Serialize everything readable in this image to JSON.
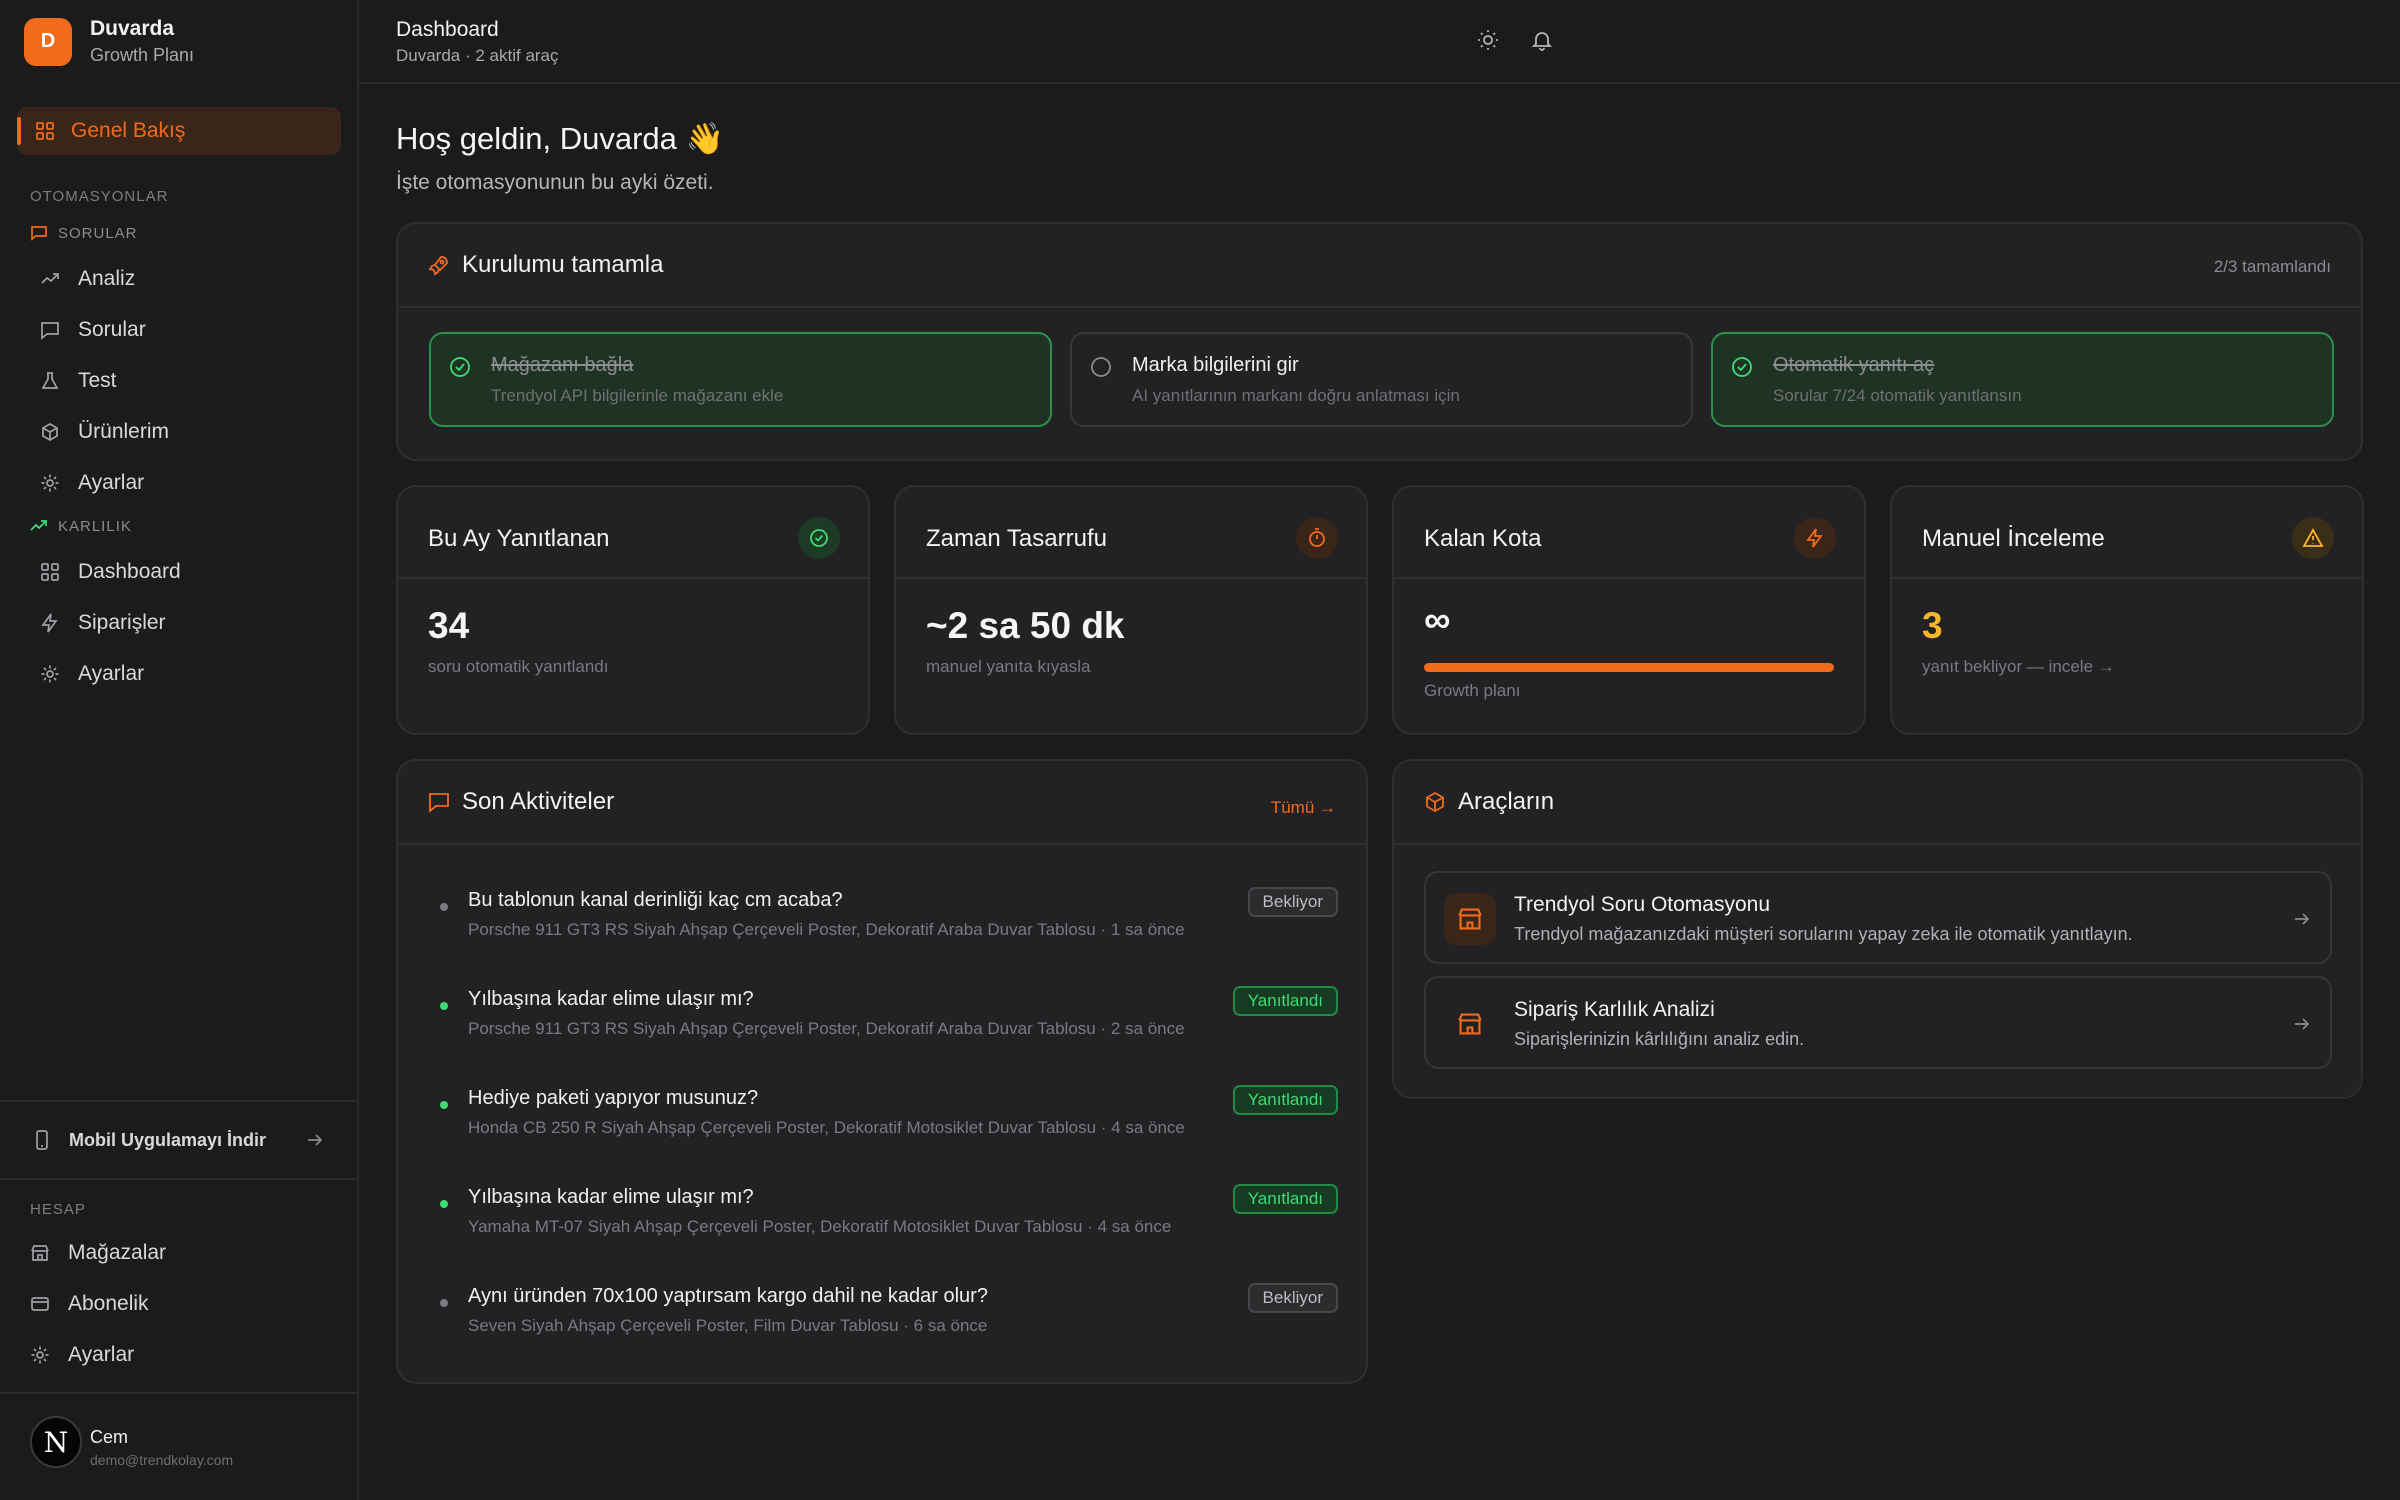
{
  "brand": {
    "initial": "D",
    "name": "Duvarda",
    "plan": "Growth Planı"
  },
  "sidebar": {
    "overview": "Genel Bakış",
    "section_automations": "OTOMASYONLAR",
    "group_questions": "SORULAR",
    "questions_items": [
      "Analiz",
      "Sorular",
      "Test",
      "Ürünlerim",
      "Ayarlar"
    ],
    "group_profit": "KARLILIK",
    "profit_items": [
      "Dashboard",
      "Siparişler",
      "Ayarlar"
    ],
    "mobile": "Mobil Uygulamayı İndir",
    "section_account": "HESAP",
    "account_items": [
      "Mağazalar",
      "Abonelik",
      "Ayarlar"
    ]
  },
  "user": {
    "initial": "N",
    "name": "Cem",
    "email": "demo@trendkolay.com"
  },
  "header": {
    "title": "Dashboard",
    "subtitle": "Duvarda · 2 aktif araç"
  },
  "welcome": {
    "title": "Hoş geldin, Duvarda 👋",
    "subtitle": "İşte otomasyonunun bu ayki özeti."
  },
  "setup": {
    "title": "Kurulumu tamamla",
    "progress": "2/3 tamamlandı",
    "steps": [
      {
        "title": "Mağazanı bağla",
        "desc": "Trendyol API bilgilerinle mağazanı ekle",
        "done": true
      },
      {
        "title": "Marka bilgilerini gir",
        "desc": "AI yanıtlarının markanı doğru anlatması için",
        "done": false
      },
      {
        "title": "Otomatik yanıtı aç",
        "desc": "Sorular 7/24 otomatik yanıtlansın",
        "done": true
      }
    ]
  },
  "stats": [
    {
      "title": "Bu Ay Yanıtlanan",
      "value": "34",
      "label": "soru otomatik yanıtlandı",
      "icon": "check-circle-icon"
    },
    {
      "title": "Zaman Tasarrufu",
      "value": "~2 sa 50 dk",
      "label": "manuel yanıta kıyasla",
      "icon": "timer-icon"
    },
    {
      "title": "Kalan Kota",
      "value": "∞",
      "label": "Growth planı",
      "icon": "bolt-icon",
      "quota_fraction": 1.0
    },
    {
      "title": "Manuel İnceleme",
      "value": "3",
      "label": "yanıt bekliyor — incele →",
      "icon": "warning-icon"
    }
  ],
  "activity": {
    "title": "Son Aktiviteler",
    "all_link": "Tümü →",
    "items": [
      {
        "question": "Bu tablonun kanal derinliği kaç cm acaba?",
        "meta": "Porsche 911 GT3 RS Siyah Ahşap Çerçeveli Poster, Dekoratif Araba Duvar Tablosu · 1 sa önce",
        "status": "Bekliyor",
        "answered": false
      },
      {
        "question": "Yılbaşına kadar elime ulaşır mı?",
        "meta": "Porsche 911 GT3 RS Siyah Ahşap Çerçeveli Poster, Dekoratif Araba Duvar Tablosu · 2 sa önce",
        "status": "Yanıtlandı",
        "answered": true
      },
      {
        "question": "Hediye paketi yapıyor musunuz?",
        "meta": "Honda CB 250 R Siyah Ahşap Çerçeveli Poster, Dekoratif Motosiklet Duvar Tablosu · 4 sa önce",
        "status": "Yanıtlandı",
        "answered": true
      },
      {
        "question": "Yılbaşına kadar elime ulaşır mı?",
        "meta": "Yamaha MT-07 Siyah Ahşap Çerçeveli Poster, Dekoratif Motosiklet Duvar Tablosu · 4 sa önce",
        "status": "Yanıtlandı",
        "answered": true
      },
      {
        "question": "Aynı üründen 70x100 yaptırsam kargo dahil ne kadar olur?",
        "meta": "Seven Siyah Ahşap Çerçeveli Poster, Film Duvar Tablosu · 6 sa önce",
        "status": "Bekliyor",
        "answered": false
      }
    ]
  },
  "tools": {
    "title": "Araçların",
    "items": [
      {
        "title": "Trendyol Soru Otomasyonu",
        "desc": "Trendyol mağazanızdaki müşteri sorularını yapay zeka ile otomatik yanıtlayın."
      },
      {
        "title": "Sipariş Karlılık Analizi",
        "desc": "Siparişlerinizin kârlılığını analiz edin."
      }
    ]
  },
  "colors": {
    "accent": "#f26a1b",
    "success": "#3edc73",
    "warning": "#f6b62b",
    "background": "#1b1b1c",
    "card": "#222224"
  }
}
